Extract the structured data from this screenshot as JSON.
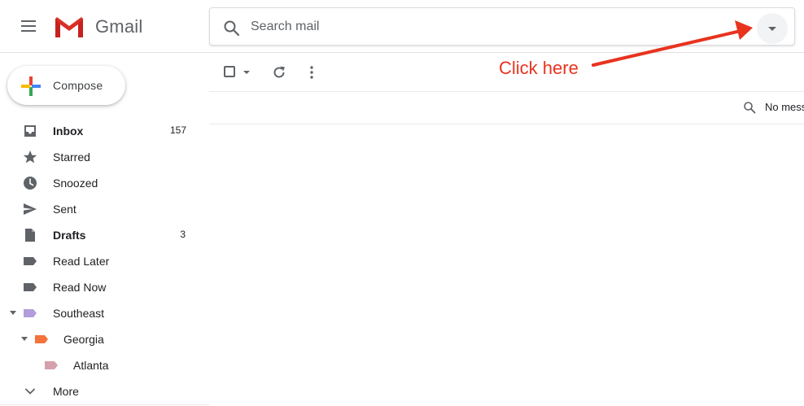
{
  "app": {
    "name": "Gmail"
  },
  "search": {
    "placeholder": "Search mail",
    "value": ""
  },
  "annotation": {
    "text": "Click here",
    "color": "#e8331f"
  },
  "compose": {
    "label": "Compose"
  },
  "sidebar": {
    "items": [
      {
        "name": "inbox",
        "label": "Inbox",
        "count": "157",
        "bold": true,
        "icon": "inbox-icon"
      },
      {
        "name": "starred",
        "label": "Starred",
        "count": "",
        "bold": false,
        "icon": "star-icon"
      },
      {
        "name": "snoozed",
        "label": "Snoozed",
        "count": "",
        "bold": false,
        "icon": "clock-icon"
      },
      {
        "name": "sent",
        "label": "Sent",
        "count": "",
        "bold": false,
        "icon": "send-icon"
      },
      {
        "name": "drafts",
        "label": "Drafts",
        "count": "3",
        "bold": true,
        "icon": "draft-icon"
      },
      {
        "name": "read-later",
        "label": "Read Later",
        "count": "",
        "bold": false,
        "icon": "label-icon",
        "color": "#5f6368"
      },
      {
        "name": "read-now",
        "label": "Read Now",
        "count": "",
        "bold": false,
        "icon": "label-icon",
        "color": "#5f6368"
      },
      {
        "name": "southeast",
        "label": "Southeast",
        "count": "",
        "bold": false,
        "icon": "label-icon",
        "color": "#b39ddb",
        "expanded": true
      },
      {
        "name": "georgia",
        "label": "Georgia",
        "count": "",
        "bold": false,
        "icon": "label-icon",
        "color": "#f4733a",
        "expanded": true
      },
      {
        "name": "atlanta",
        "label": "Atlanta",
        "count": "",
        "bold": false,
        "icon": "label-icon",
        "color": "#d5a0ab"
      },
      {
        "name": "more",
        "label": "More",
        "count": "",
        "bold": false,
        "icon": "chevron-down-icon"
      }
    ]
  },
  "main": {
    "empty_text": "No mess"
  }
}
